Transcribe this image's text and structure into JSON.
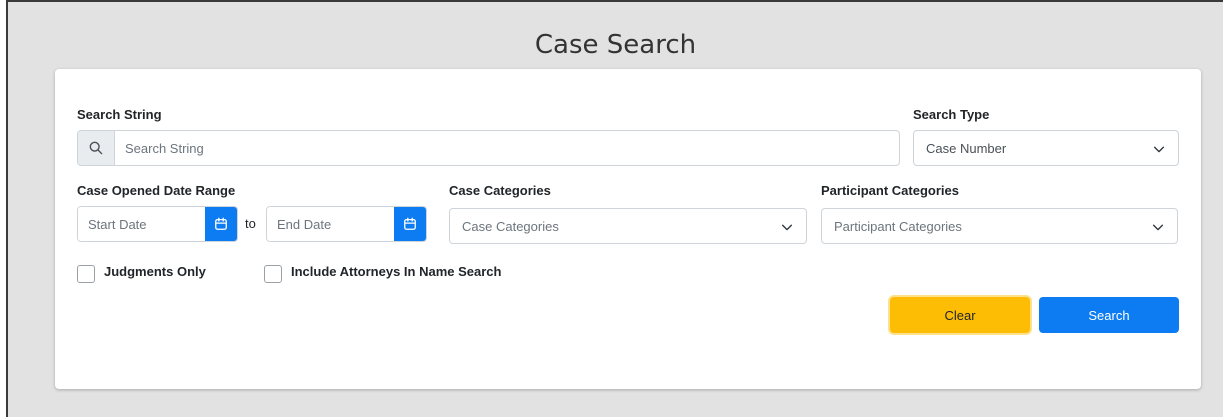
{
  "page": {
    "title": "Case Search"
  },
  "form": {
    "search_string": {
      "label": "Search String",
      "placeholder": "Search String"
    },
    "search_type": {
      "label": "Search Type",
      "selected": "Case Number"
    },
    "date_range": {
      "label": "Case Opened Date Range",
      "start_placeholder": "Start Date",
      "to_label": "to",
      "end_placeholder": "End Date"
    },
    "case_categories": {
      "label": "Case Categories",
      "placeholder": "Case Categories"
    },
    "participant_categories": {
      "label": "Participant Categories",
      "placeholder": "Participant Categories"
    },
    "checkboxes": {
      "judgments_only": {
        "label": "Judgments Only",
        "checked": false
      },
      "include_attorneys": {
        "label": "Include Attorneys In Name Search",
        "checked": false
      }
    },
    "buttons": {
      "clear": "Clear",
      "search": "Search"
    }
  },
  "icons": {
    "search": "search-icon",
    "calendar": "calendar-icon",
    "chevron": "chevron-down-icon"
  },
  "colors": {
    "primary": "#0d7cf2",
    "warning": "#fdbd05"
  }
}
